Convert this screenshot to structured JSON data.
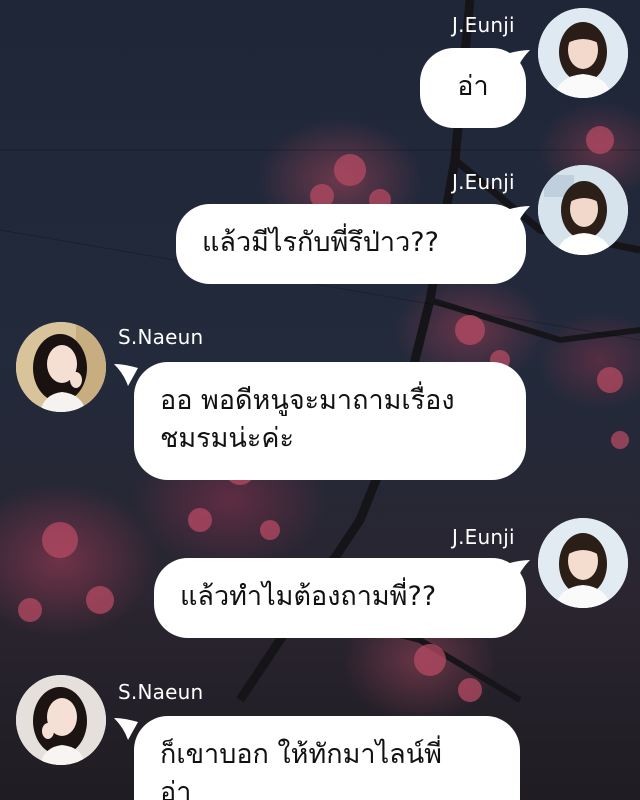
{
  "messages": [
    {
      "sender": "J.Eunji",
      "side": "right",
      "text": "อ่า"
    },
    {
      "sender": "J.Eunji",
      "side": "right",
      "text": "แล้วมีไรกับพี่รึป่าว??"
    },
    {
      "sender": "S.Naeun",
      "side": "left",
      "text": "ออ พอดีหนูจะมาถามเรื่อง\nชมรมน่ะค่ะ"
    },
    {
      "sender": "J.Eunji",
      "side": "right",
      "text": "แล้วทำไมต้องถามพี่??"
    },
    {
      "sender": "S.Naeun",
      "side": "left",
      "text": "ก็เขาบอก ให้ทักมาไลน์พี่\nอ่า"
    }
  ]
}
